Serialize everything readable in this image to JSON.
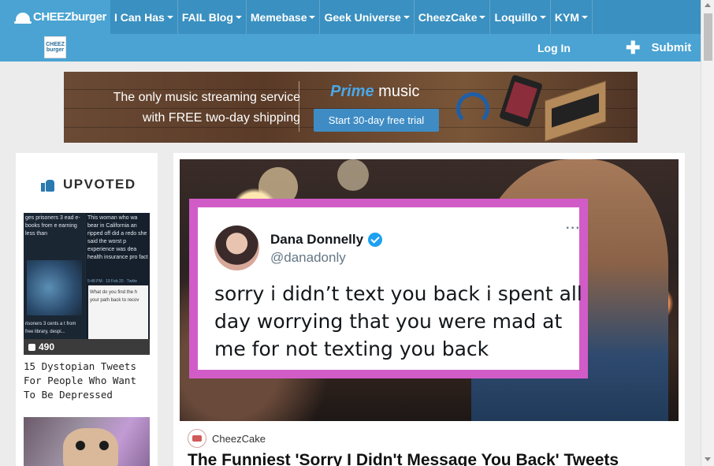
{
  "brand": {
    "logo_text": "CHEEZburger"
  },
  "nav": {
    "items": [
      {
        "label": "I Can Has"
      },
      {
        "label": "FAIL Blog"
      },
      {
        "label": "Memebase"
      },
      {
        "label": "Geek Universe"
      },
      {
        "label": "CheezCake"
      },
      {
        "label": "Loquillo"
      },
      {
        "label": "KYM"
      }
    ]
  },
  "subnav": {
    "logo_line1": "CHEEZ",
    "logo_line2": "burger",
    "login_label": "Log In",
    "submit_label": "Submit"
  },
  "ad": {
    "line1": "The only music streaming service",
    "line2": "with FREE two-day shipping",
    "prime_word": "Prime",
    "music_word": "music",
    "cta": "Start 30-day free trial"
  },
  "sidebar": {
    "heading": "UPVOTED",
    "item": {
      "thumb_left_text": "ges prisoners 3 ead e-books from e earning less than",
      "thumb_right_text": "This woman who wa bear in California an ripped off did a redo she said the worst p experience was dea health insurance pro fact",
      "thumb_meta": "5:48 PM · 19 Feb 20 · Twitte",
      "thumb_bottom_left": "risoners 3 cents a t from free library, despi...",
      "thumb_bottom_right": "What do you find the h your path back to recov",
      "votes": "490",
      "title": "15 Dystopian Tweets For People Who Want To Be Depressed"
    }
  },
  "article": {
    "tweet": {
      "name": "Dana Donnelly",
      "handle": "@danadonly",
      "more": "···",
      "text": "sorry i didn’t text you back i spent all day worrying that you were mad at me for not texting you back"
    },
    "source": "CheezCake",
    "title": "The Funniest 'Sorry I Didn't Message You Back' Tweets"
  },
  "colors": {
    "topnav": "#3a90c0",
    "subnav": "#4aa3d2",
    "tweet_border": "#d15cc8",
    "verified": "#1da1f2"
  }
}
